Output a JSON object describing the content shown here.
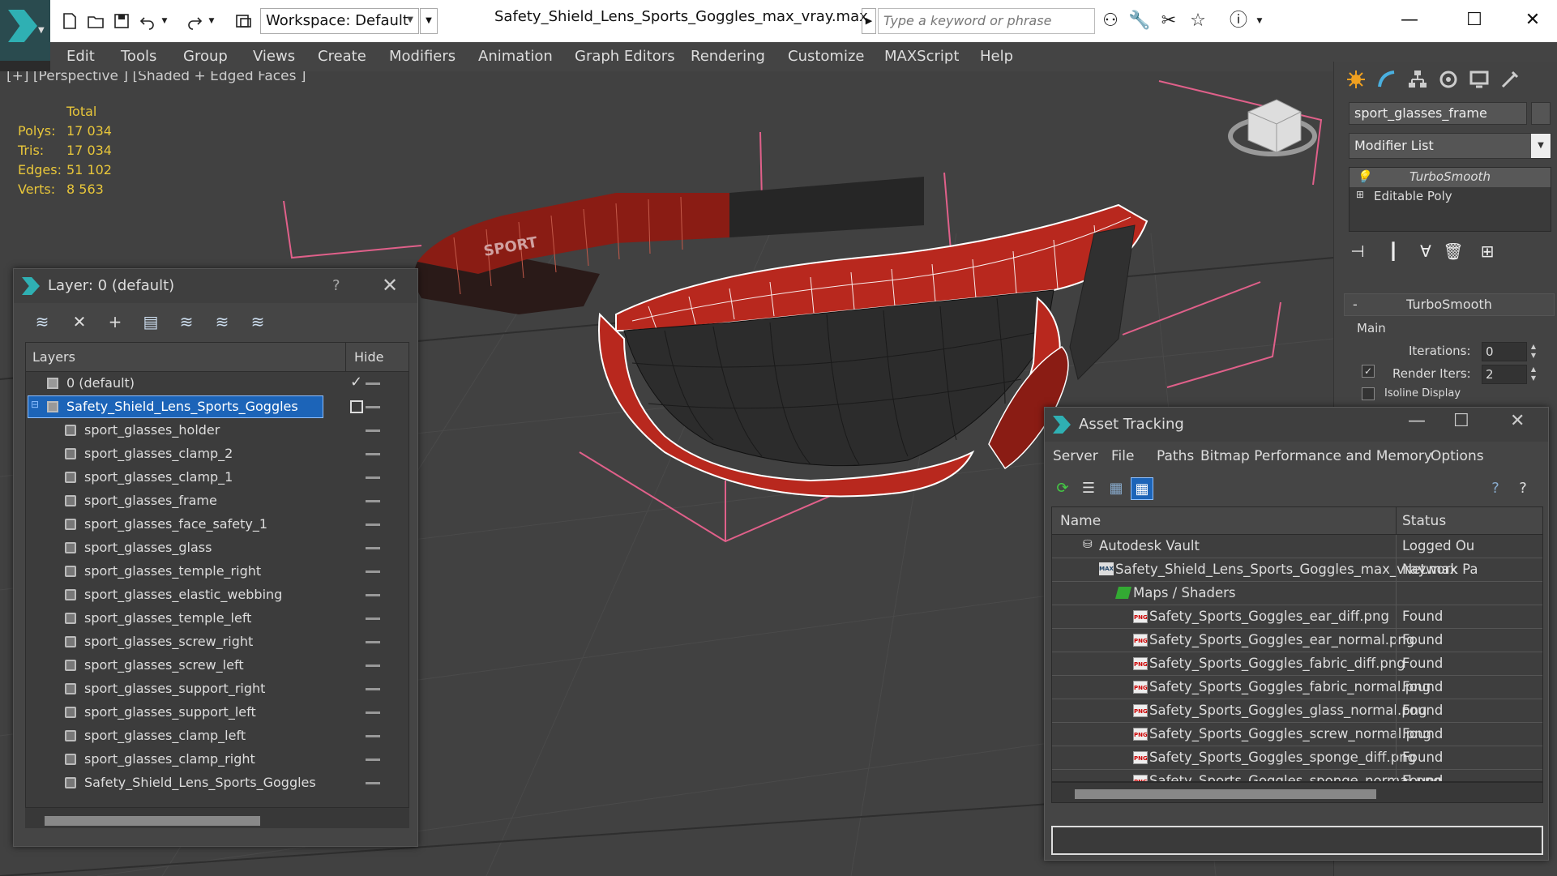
{
  "window": {
    "title": "Safety_Shield_Lens_Sports_Goggles_max_vray.max",
    "workspace_label": "Workspace: Default",
    "search_placeholder": "Type a keyword or phrase"
  },
  "menus": [
    "Edit",
    "Tools",
    "Group",
    "Views",
    "Create",
    "Modifiers",
    "Animation",
    "Graph Editors",
    "Rendering",
    "Customize",
    "MAXScript",
    "Help"
  ],
  "viewport": {
    "label": "[+] [Perspective ] [Shaded + Edged Faces ]",
    "stats": {
      "header": "Total",
      "rows": [
        {
          "k": "Polys:",
          "v": "17 034"
        },
        {
          "k": "Tris:",
          "v": "17 034"
        },
        {
          "k": "Edges:",
          "v": "51 102"
        },
        {
          "k": "Verts:",
          "v": "8 563"
        }
      ]
    },
    "model_text": "SPORT"
  },
  "command_panel": {
    "object_name": "sport_glasses_frame",
    "modifier_list": "Modifier List",
    "stack": [
      "TurboSmooth",
      "Editable Poly"
    ],
    "rollout_title": "TurboSmooth",
    "group_main": "Main",
    "iterations_label": "Iterations:",
    "iterations_value": "0",
    "render_iters_label": "Render Iters:",
    "render_iters_value": "2",
    "isoline_label": "Isoline Display"
  },
  "layer_dialog": {
    "title": "Layer: 0 (default)",
    "help": "?",
    "col_layers": "Layers",
    "col_hide": "Hide",
    "layers": [
      "0 (default)",
      "Safety_Shield_Lens_Sports_Goggles"
    ],
    "objects": [
      "sport_glasses_holder",
      "sport_glasses_clamp_2",
      "sport_glasses_clamp_1",
      "sport_glasses_frame",
      "sport_glasses_face_safety_1",
      "sport_glasses_glass",
      "sport_glasses_temple_right",
      "sport_glasses_elastic_webbing",
      "sport_glasses_temple_left",
      "sport_glasses_screw_right",
      "sport_glasses_screw_left",
      "sport_glasses_support_right",
      "sport_glasses_support_left",
      "sport_glasses_clamp_left",
      "sport_glasses_clamp_right",
      "Safety_Shield_Lens_Sports_Goggles"
    ]
  },
  "asset_dialog": {
    "title": "Asset Tracking",
    "menus": [
      "Server",
      "File",
      "Paths",
      "Bitmap Performance and Memory",
      "Options"
    ],
    "col_name": "Name",
    "col_status": "Status",
    "vault": {
      "name": "Autodesk Vault",
      "status": "Logged Ou"
    },
    "file": {
      "name": "Safety_Shield_Lens_Sports_Goggles_max_vray.max",
      "status": "Network Pa"
    },
    "maps_label": "Maps / Shaders",
    "maps": [
      {
        "name": "Safety_Sports_Goggles_ear_diff.png",
        "status": "Found"
      },
      {
        "name": "Safety_Sports_Goggles_ear_normal.png",
        "status": "Found"
      },
      {
        "name": "Safety_Sports_Goggles_fabric_diff.png",
        "status": "Found"
      },
      {
        "name": "Safety_Sports_Goggles_fabric_normal.png",
        "status": "Found"
      },
      {
        "name": "Safety_Sports_Goggles_glass_normal.png",
        "status": "Found"
      },
      {
        "name": "Safety_Sports_Goggles_screw_normal.png",
        "status": "Found"
      },
      {
        "name": "Safety_Sports_Goggles_sponge_diff.png",
        "status": "Found"
      },
      {
        "name": "Safety_Sports_Goggles_sponge_normal.png",
        "status": "Found"
      }
    ]
  },
  "colors": {
    "stats_yellow": "#e8c63a",
    "selection_blue": "#1c64b8",
    "frame_red": "#b8281e",
    "bbox_pink": "#e0608a",
    "brand_teal": "#2fb0b3"
  }
}
